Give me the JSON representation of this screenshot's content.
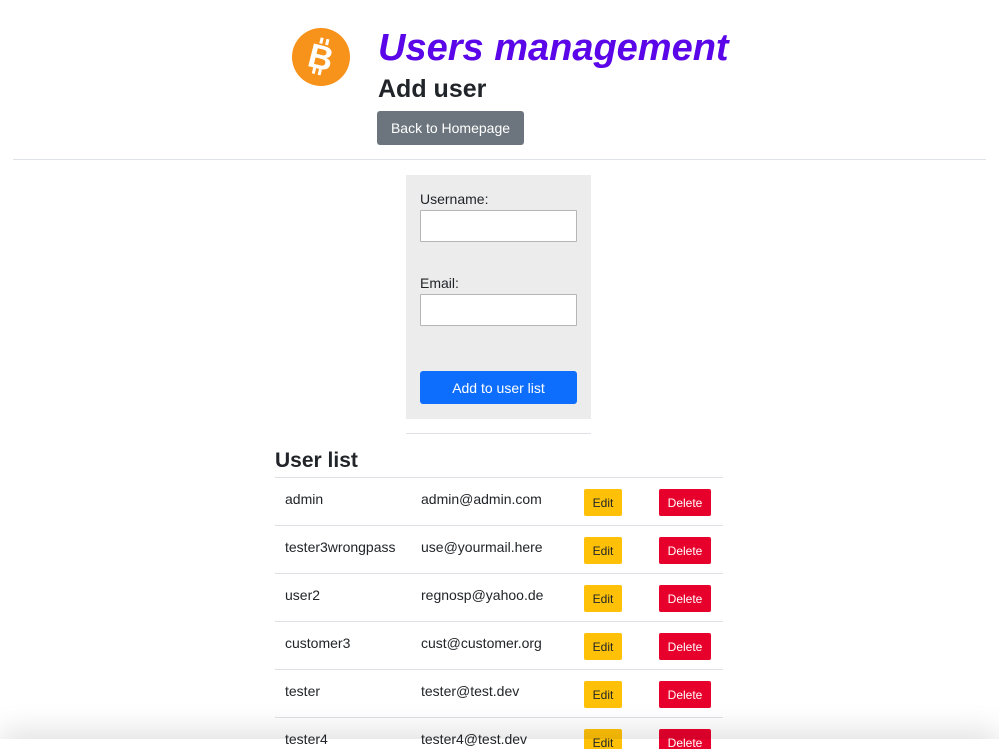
{
  "header": {
    "logo_icon": "bitcoin-icon",
    "logo_color": "#f7931a",
    "title": "Users management",
    "title_color": "#5a06e8",
    "subtitle": "Add user",
    "back_label": "Back to Homepage"
  },
  "form": {
    "username_label": "Username:",
    "username_value": "",
    "email_label": "Email:",
    "email_value": "",
    "submit_label": "Add to user list"
  },
  "user_list": {
    "title": "User list",
    "edit_label": "Edit",
    "delete_label": "Delete",
    "rows": [
      {
        "username": "admin",
        "email": "admin@admin.com"
      },
      {
        "username": "tester3wrongpass",
        "email": "use@yourmail.here"
      },
      {
        "username": "user2",
        "email": "regnosp@yahoo.de"
      },
      {
        "username": "customer3",
        "email": "cust@customer.org"
      },
      {
        "username": "tester",
        "email": "tester@test.dev"
      },
      {
        "username": "tester4",
        "email": "tester4@test.dev"
      }
    ]
  },
  "colors": {
    "back_button": "#6c757d",
    "add_button": "#0d6efd",
    "edit_button": "#ffc107",
    "delete_button": "#e8002d",
    "form_background": "#ececec"
  }
}
